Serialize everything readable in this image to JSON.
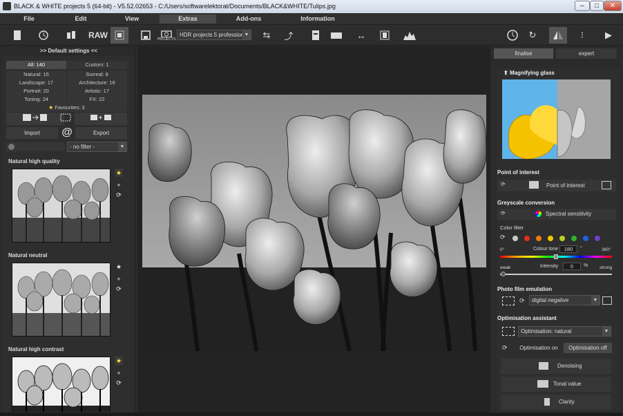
{
  "window": {
    "title": "BLACK & WHITE projects 5 (64-bit) - V5.52.02653 - C:/Users/softwarelektorat/Documents/BLACK&WHITE/Tulips.jpg",
    "minimize": "–",
    "maximize": "□",
    "close": "✕"
  },
  "menu": [
    "File",
    "Edit",
    "View",
    "Extras",
    "Add-ons",
    "Information"
  ],
  "toolbar": {
    "raw_label": "RAW",
    "projects_label": "PROJECTS",
    "hdr_select": "HDR projects 5 professional"
  },
  "left_panel": {
    "header": ">> Default settings <<",
    "counts": {
      "all": "All: 140",
      "custom": "Custom: 1",
      "natural": "Natural: 15",
      "surreal": "Surreal: 8",
      "landscape": "Landscape: 17",
      "architecture": "Architecture: 16",
      "portrait": "Portrait: 20",
      "artistic": "Artistic: 17",
      "toning": "Toning: 24",
      "fx": "FX: 22",
      "favourites": "Favourites: 3"
    },
    "import_label": "Import",
    "export_label": "Export",
    "at_label": "@",
    "filter_value": "- no filter -",
    "presets": [
      {
        "title": "Natural high quality",
        "fav": true
      },
      {
        "title": "Natural neutral",
        "fav": false
      },
      {
        "title": "Natural high contrast",
        "fav": true
      }
    ]
  },
  "right_panel": {
    "tabs": {
      "finalise": "finalise",
      "expert": "expert"
    },
    "magnifying_glass": "Magnifying glass",
    "point_of_interest": {
      "title": "Point of interest",
      "label": "Point of interest"
    },
    "greyscale": {
      "title": "Greyscale conversion",
      "spectral": "Spectral sensitivity",
      "color_filter": "Color filter",
      "tone_min": "0°",
      "tone_label": "Colour tone",
      "tone_value": "180",
      "tone_unit": "°",
      "tone_max": "360°",
      "weak": "weak",
      "intensity_label": "Intensity",
      "intensity_value": "0",
      "intensity_unit": "%",
      "strong": "strong",
      "filter_colors": [
        "#c8c8c8",
        "#e03020",
        "#f07a10",
        "#f0c800",
        "#b8d020",
        "#30b030",
        "#2060e0",
        "#7040c8"
      ]
    },
    "film": {
      "title": "Photo film emulation",
      "value": "digital negative"
    },
    "optimisation": {
      "title": "Optimisation assistant",
      "value": "Optimisation: natural",
      "on": "Optimisation on",
      "off": "Optimisation off",
      "denoising": "Denoising",
      "tonal": "Tonal value",
      "clarity": "Clarity"
    }
  }
}
